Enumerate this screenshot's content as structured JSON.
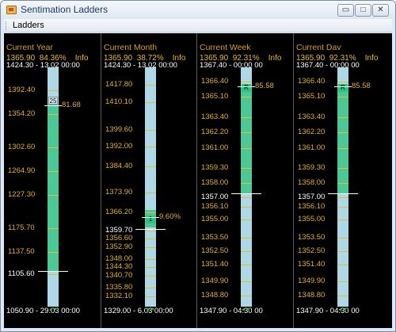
{
  "window": {
    "title": "Sentimation Ladders",
    "controls": {
      "minimize": "▭",
      "maximize": "□",
      "close": "✕"
    }
  },
  "menu": {
    "ladders": "Ladders"
  },
  "panels": [
    {
      "title": "Current Year",
      "price": "1365.90",
      "percent": "84.36%",
      "info": "Info",
      "range_top": "1424.30 - 13.02 00:00",
      "range_bottom": "1050.90 - 29.03 00:00",
      "marker_label": "25",
      "pct_label": "81.68",
      "current_price": "1105.60",
      "labels": [
        "1392.40",
        "1354.20",
        "1302.60",
        "1264.90",
        "1227.30",
        "1175.70",
        "1137.50",
        "1105.60"
      ]
    },
    {
      "title": "Current Month",
      "price": "1365.90",
      "percent": "38.72%",
      "info": "Info",
      "range_top": "1424.30 - 13.02 00:00",
      "range_bottom": "1329.00 - 6.03 00:00",
      "marker_label": "1",
      "pct_label": "9.60%",
      "current_price": "1359.70",
      "labels": [
        "1417.80",
        "1410.10",
        "1399.60",
        "1392.00",
        "1384.40",
        "1373.90",
        "1366.20",
        "1359.70",
        "1356.60",
        "1352.90",
        "1348.00",
        "1344.30",
        "1340.70",
        "1335.80",
        "1332.10"
      ]
    },
    {
      "title": "Current Week",
      "price": "1365.90",
      "percent": "92.31%",
      "info": "Info",
      "range_top": "1367.40 - 00:00 00",
      "range_bottom": "1347.90 - 04:30 00",
      "marker_label": "R",
      "pct_label": "85.58",
      "current_price": "1357.00",
      "labels": [
        "1366.40",
        "1365.10",
        "1363.40",
        "1362.20",
        "1361.00",
        "1359.30",
        "1358.00",
        "1357.00",
        "1356.10",
        "1355.00",
        "1353.50",
        "1352.50",
        "1351.40",
        "1349.90",
        "1348.80"
      ]
    },
    {
      "title": "Current Dav",
      "price": "1365.90",
      "percent": "92.31%",
      "info": "Info",
      "range_top": "1367.40 - 00:00 00",
      "range_bottom": "1347.90 - 04:30 00",
      "marker_label": "R",
      "pct_label": "85.58",
      "current_price": "1357.00",
      "labels": [
        "1366.40",
        "1365.10",
        "1363.40",
        "1362.20",
        "1361.00",
        "1359.30",
        "1358.00",
        "1357.00",
        "1356.10",
        "1355.00",
        "1353.50",
        "1352.50",
        "1351.40",
        "1349.90",
        "1348.80"
      ]
    }
  ],
  "colors": {
    "panel_bg": "#000000",
    "title": "#d4a020",
    "label": "#e0b030",
    "ladder": "#aed8e6",
    "fill": "#4cc896",
    "marker": "#2ec27e",
    "arrow": "#30c030"
  }
}
